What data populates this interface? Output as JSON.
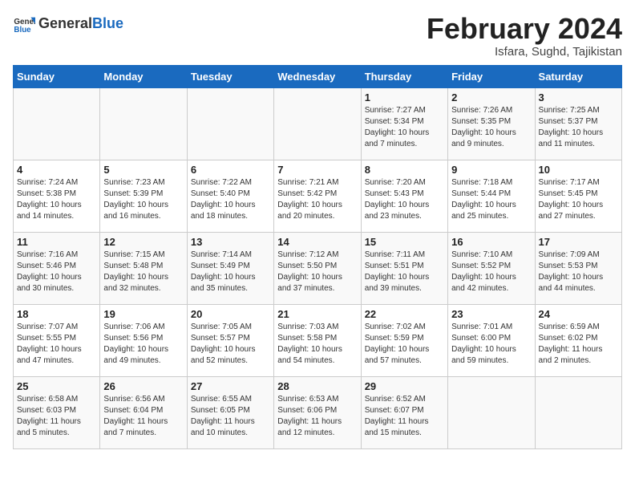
{
  "header": {
    "logo_general": "General",
    "logo_blue": "Blue",
    "main_title": "February 2024",
    "subtitle": "Isfara, Sughd, Tajikistan"
  },
  "calendar": {
    "days_of_week": [
      "Sunday",
      "Monday",
      "Tuesday",
      "Wednesday",
      "Thursday",
      "Friday",
      "Saturday"
    ],
    "weeks": [
      [
        {
          "day": "",
          "info": ""
        },
        {
          "day": "",
          "info": ""
        },
        {
          "day": "",
          "info": ""
        },
        {
          "day": "",
          "info": ""
        },
        {
          "day": "1",
          "info": "Sunrise: 7:27 AM\nSunset: 5:34 PM\nDaylight: 10 hours\nand 7 minutes."
        },
        {
          "day": "2",
          "info": "Sunrise: 7:26 AM\nSunset: 5:35 PM\nDaylight: 10 hours\nand 9 minutes."
        },
        {
          "day": "3",
          "info": "Sunrise: 7:25 AM\nSunset: 5:37 PM\nDaylight: 10 hours\nand 11 minutes."
        }
      ],
      [
        {
          "day": "4",
          "info": "Sunrise: 7:24 AM\nSunset: 5:38 PM\nDaylight: 10 hours\nand 14 minutes."
        },
        {
          "day": "5",
          "info": "Sunrise: 7:23 AM\nSunset: 5:39 PM\nDaylight: 10 hours\nand 16 minutes."
        },
        {
          "day": "6",
          "info": "Sunrise: 7:22 AM\nSunset: 5:40 PM\nDaylight: 10 hours\nand 18 minutes."
        },
        {
          "day": "7",
          "info": "Sunrise: 7:21 AM\nSunset: 5:42 PM\nDaylight: 10 hours\nand 20 minutes."
        },
        {
          "day": "8",
          "info": "Sunrise: 7:20 AM\nSunset: 5:43 PM\nDaylight: 10 hours\nand 23 minutes."
        },
        {
          "day": "9",
          "info": "Sunrise: 7:18 AM\nSunset: 5:44 PM\nDaylight: 10 hours\nand 25 minutes."
        },
        {
          "day": "10",
          "info": "Sunrise: 7:17 AM\nSunset: 5:45 PM\nDaylight: 10 hours\nand 27 minutes."
        }
      ],
      [
        {
          "day": "11",
          "info": "Sunrise: 7:16 AM\nSunset: 5:46 PM\nDaylight: 10 hours\nand 30 minutes."
        },
        {
          "day": "12",
          "info": "Sunrise: 7:15 AM\nSunset: 5:48 PM\nDaylight: 10 hours\nand 32 minutes."
        },
        {
          "day": "13",
          "info": "Sunrise: 7:14 AM\nSunset: 5:49 PM\nDaylight: 10 hours\nand 35 minutes."
        },
        {
          "day": "14",
          "info": "Sunrise: 7:12 AM\nSunset: 5:50 PM\nDaylight: 10 hours\nand 37 minutes."
        },
        {
          "day": "15",
          "info": "Sunrise: 7:11 AM\nSunset: 5:51 PM\nDaylight: 10 hours\nand 39 minutes."
        },
        {
          "day": "16",
          "info": "Sunrise: 7:10 AM\nSunset: 5:52 PM\nDaylight: 10 hours\nand 42 minutes."
        },
        {
          "day": "17",
          "info": "Sunrise: 7:09 AM\nSunset: 5:53 PM\nDaylight: 10 hours\nand 44 minutes."
        }
      ],
      [
        {
          "day": "18",
          "info": "Sunrise: 7:07 AM\nSunset: 5:55 PM\nDaylight: 10 hours\nand 47 minutes."
        },
        {
          "day": "19",
          "info": "Sunrise: 7:06 AM\nSunset: 5:56 PM\nDaylight: 10 hours\nand 49 minutes."
        },
        {
          "day": "20",
          "info": "Sunrise: 7:05 AM\nSunset: 5:57 PM\nDaylight: 10 hours\nand 52 minutes."
        },
        {
          "day": "21",
          "info": "Sunrise: 7:03 AM\nSunset: 5:58 PM\nDaylight: 10 hours\nand 54 minutes."
        },
        {
          "day": "22",
          "info": "Sunrise: 7:02 AM\nSunset: 5:59 PM\nDaylight: 10 hours\nand 57 minutes."
        },
        {
          "day": "23",
          "info": "Sunrise: 7:01 AM\nSunset: 6:00 PM\nDaylight: 10 hours\nand 59 minutes."
        },
        {
          "day": "24",
          "info": "Sunrise: 6:59 AM\nSunset: 6:02 PM\nDaylight: 11 hours\nand 2 minutes."
        }
      ],
      [
        {
          "day": "25",
          "info": "Sunrise: 6:58 AM\nSunset: 6:03 PM\nDaylight: 11 hours\nand 5 minutes."
        },
        {
          "day": "26",
          "info": "Sunrise: 6:56 AM\nSunset: 6:04 PM\nDaylight: 11 hours\nand 7 minutes."
        },
        {
          "day": "27",
          "info": "Sunrise: 6:55 AM\nSunset: 6:05 PM\nDaylight: 11 hours\nand 10 minutes."
        },
        {
          "day": "28",
          "info": "Sunrise: 6:53 AM\nSunset: 6:06 PM\nDaylight: 11 hours\nand 12 minutes."
        },
        {
          "day": "29",
          "info": "Sunrise: 6:52 AM\nSunset: 6:07 PM\nDaylight: 11 hours\nand 15 minutes."
        },
        {
          "day": "",
          "info": ""
        },
        {
          "day": "",
          "info": ""
        }
      ]
    ]
  }
}
